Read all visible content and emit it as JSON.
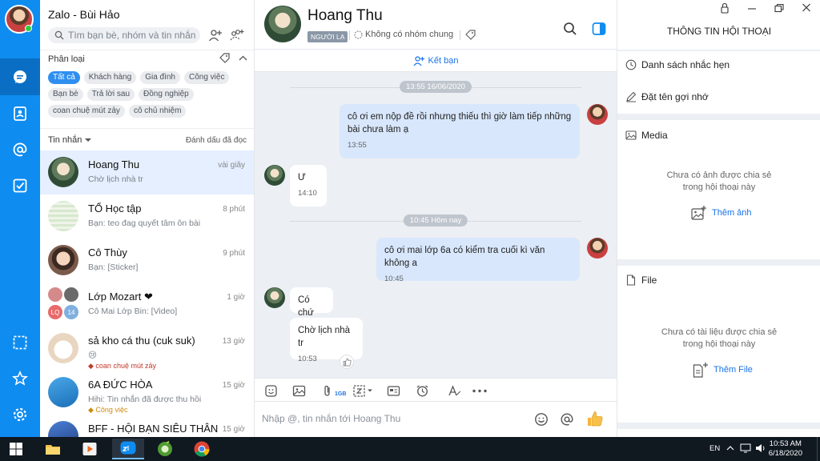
{
  "app": {
    "title": "Zalo - Bùi Hảo",
    "search_placeholder": "Tìm bạn bè, nhóm và tin nhắn"
  },
  "nav": {
    "items": [
      "messages",
      "contacts",
      "mentions",
      "todo",
      "screenshot",
      "favorites",
      "settings"
    ],
    "accent": "#0f8cf0"
  },
  "classify": {
    "title": "Phân loại",
    "tags": [
      "Tất cả",
      "Khách hàng",
      "Gia đình",
      "Công việc",
      "Bạn bè",
      "Trả lời sau",
      "Đồng nghiệp",
      "coan chuệ mút zảy",
      "cô chủ nhiệm"
    ],
    "active_tag": "Tất cả"
  },
  "messages_header": {
    "label": "Tin nhắn",
    "mark_read": "Đánh dấu đã đọc"
  },
  "conversations": [
    {
      "name": "Hoang Thu",
      "time": "vài giây",
      "preview": "Chờ lịch nhà tr",
      "active": true
    },
    {
      "name": "TỔ Học tập",
      "time": "8 phút",
      "preview": "Bạn: teo đag quyết tâm ôn bài"
    },
    {
      "name": "Cô Thùy",
      "time": "9 phút",
      "preview": "Bạn: [Sticker]"
    },
    {
      "name": "Lớp Mozart ❤",
      "time": "1 giờ",
      "preview": "Cô Mai Lớp Bin: [Video]",
      "group_initials": "LQ",
      "group_count": "14"
    },
    {
      "name": "sả kho cá thu (cuk suk)",
      "time": "13 giờ",
      "preview": "😢",
      "label": "coan chuệ mút zảy"
    },
    {
      "name": "6A ĐỨC HÒA",
      "time": "15 giờ",
      "preview": "Hihi: Tin nhắn đã được thu hồi",
      "label": "Công việc"
    },
    {
      "name": "BFF - HỘI BẠN SIÊU THÂN",
      "time": "15 giờ",
      "preview": ""
    }
  ],
  "chat": {
    "name": "Hoang Thu",
    "badge": "NGƯỜI LẠ",
    "group_info": "Không có nhóm chung",
    "add_friend": "Kết bạn",
    "dividers": [
      "13:55 16/06/2020",
      "10:45 Hôm nay"
    ],
    "messages": [
      {
        "dir": "out",
        "text": "cô ơi em nộp đề rồi nhưng thiếu thì giờ làm tiếp những bài chưa làm ạ",
        "time": "13:55"
      },
      {
        "dir": "in",
        "text": "Ư",
        "time": "14:10"
      },
      {
        "dir": "out",
        "text": "cô ơi mai lớp 6a có kiểm tra cuối kì văn không a",
        "time": "10:45"
      },
      {
        "dir": "in",
        "text": "Có chứ",
        "time": ""
      },
      {
        "dir": "in",
        "text": "Chờ lịch nhà tr",
        "time": "10:53"
      }
    ],
    "attach_size": "1GB",
    "input_placeholder": "Nhập @, tin nhắn tới Hoang Thu"
  },
  "info_panel": {
    "title": "THÔNG TIN HỘI THOẠI",
    "reminders": "Danh sách nhắc hẹn",
    "nickname": "Đặt tên gợi nhớ",
    "media_title": "Media",
    "media_empty": "Chưa có ảnh được chia sẻ trong hội thoại này",
    "add_photo": "Thêm ảnh",
    "file_title": "File",
    "file_empty": "Chưa có tài liệu được chia sẻ trong hội thoại này",
    "add_file": "Thêm File"
  },
  "taskbar": {
    "lang": "EN",
    "time": "10:53 AM",
    "date": "6/18/2020"
  }
}
